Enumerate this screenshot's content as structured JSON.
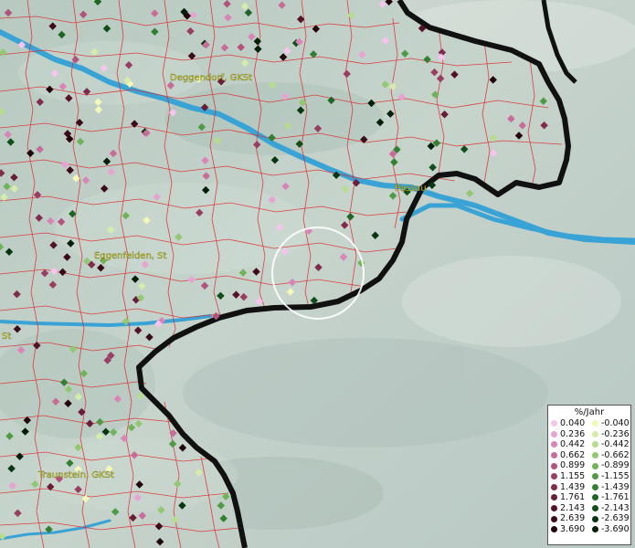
{
  "map": {
    "places": [
      {
        "id": "deggendorf",
        "label": "Deggendorf, GKSt"
      },
      {
        "id": "passau",
        "label": "Passau"
      },
      {
        "id": "eggenfelden",
        "label": "Eggenfelden, St"
      },
      {
        "id": "st-left",
        "label": "St"
      },
      {
        "id": "traunstein",
        "label": "Traunstein, GKSt"
      }
    ],
    "colors": {
      "boundary": "#e0262a",
      "border": "#111111",
      "river": "#3aa3d6",
      "selection_circle": "#ffffff"
    }
  },
  "legend": {
    "title": "%/Jahr",
    "positive": [
      {
        "value": "0.040",
        "color": "#f6c4ec"
      },
      {
        "value": "0.236",
        "color": "#e7a3d2"
      },
      {
        "value": "0.442",
        "color": "#d985b8"
      },
      {
        "value": "0.662",
        "color": "#c96c9a"
      },
      {
        "value": "0.899",
        "color": "#b2527d"
      },
      {
        "value": "1.155",
        "color": "#9a3d63"
      },
      {
        "value": "1.439",
        "color": "#822c4d"
      },
      {
        "value": "1.761",
        "color": "#6a1d39"
      },
      {
        "value": "2.143",
        "color": "#531228"
      },
      {
        "value": "2.639",
        "color": "#3c0a1a"
      },
      {
        "value": "3.690",
        "color": "#22030b"
      }
    ],
    "negative": [
      {
        "value": "-0.040",
        "color": "#f3f7b8"
      },
      {
        "value": "-0.236",
        "color": "#d6ecaa"
      },
      {
        "value": "-0.442",
        "color": "#b6dc8e"
      },
      {
        "value": "-0.662",
        "color": "#93c872"
      },
      {
        "value": "-0.899",
        "color": "#71b35a"
      },
      {
        "value": "-1.155",
        "color": "#4f9b44"
      },
      {
        "value": "-1.439",
        "color": "#338033"
      },
      {
        "value": "-1.761",
        "color": "#1f6626"
      },
      {
        "value": "-2.143",
        "color": "#114e1a"
      },
      {
        "value": "-2.639",
        "color": "#073710"
      },
      {
        "value": "-3.690",
        "color": "#021f07"
      }
    ]
  }
}
